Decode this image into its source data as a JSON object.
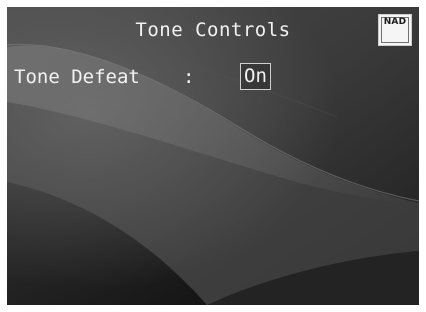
{
  "screen": {
    "title": "Tone Controls",
    "logo_text": "NAD"
  },
  "setting": {
    "label": "Tone Defeat",
    "separator": ":",
    "value": "On"
  }
}
